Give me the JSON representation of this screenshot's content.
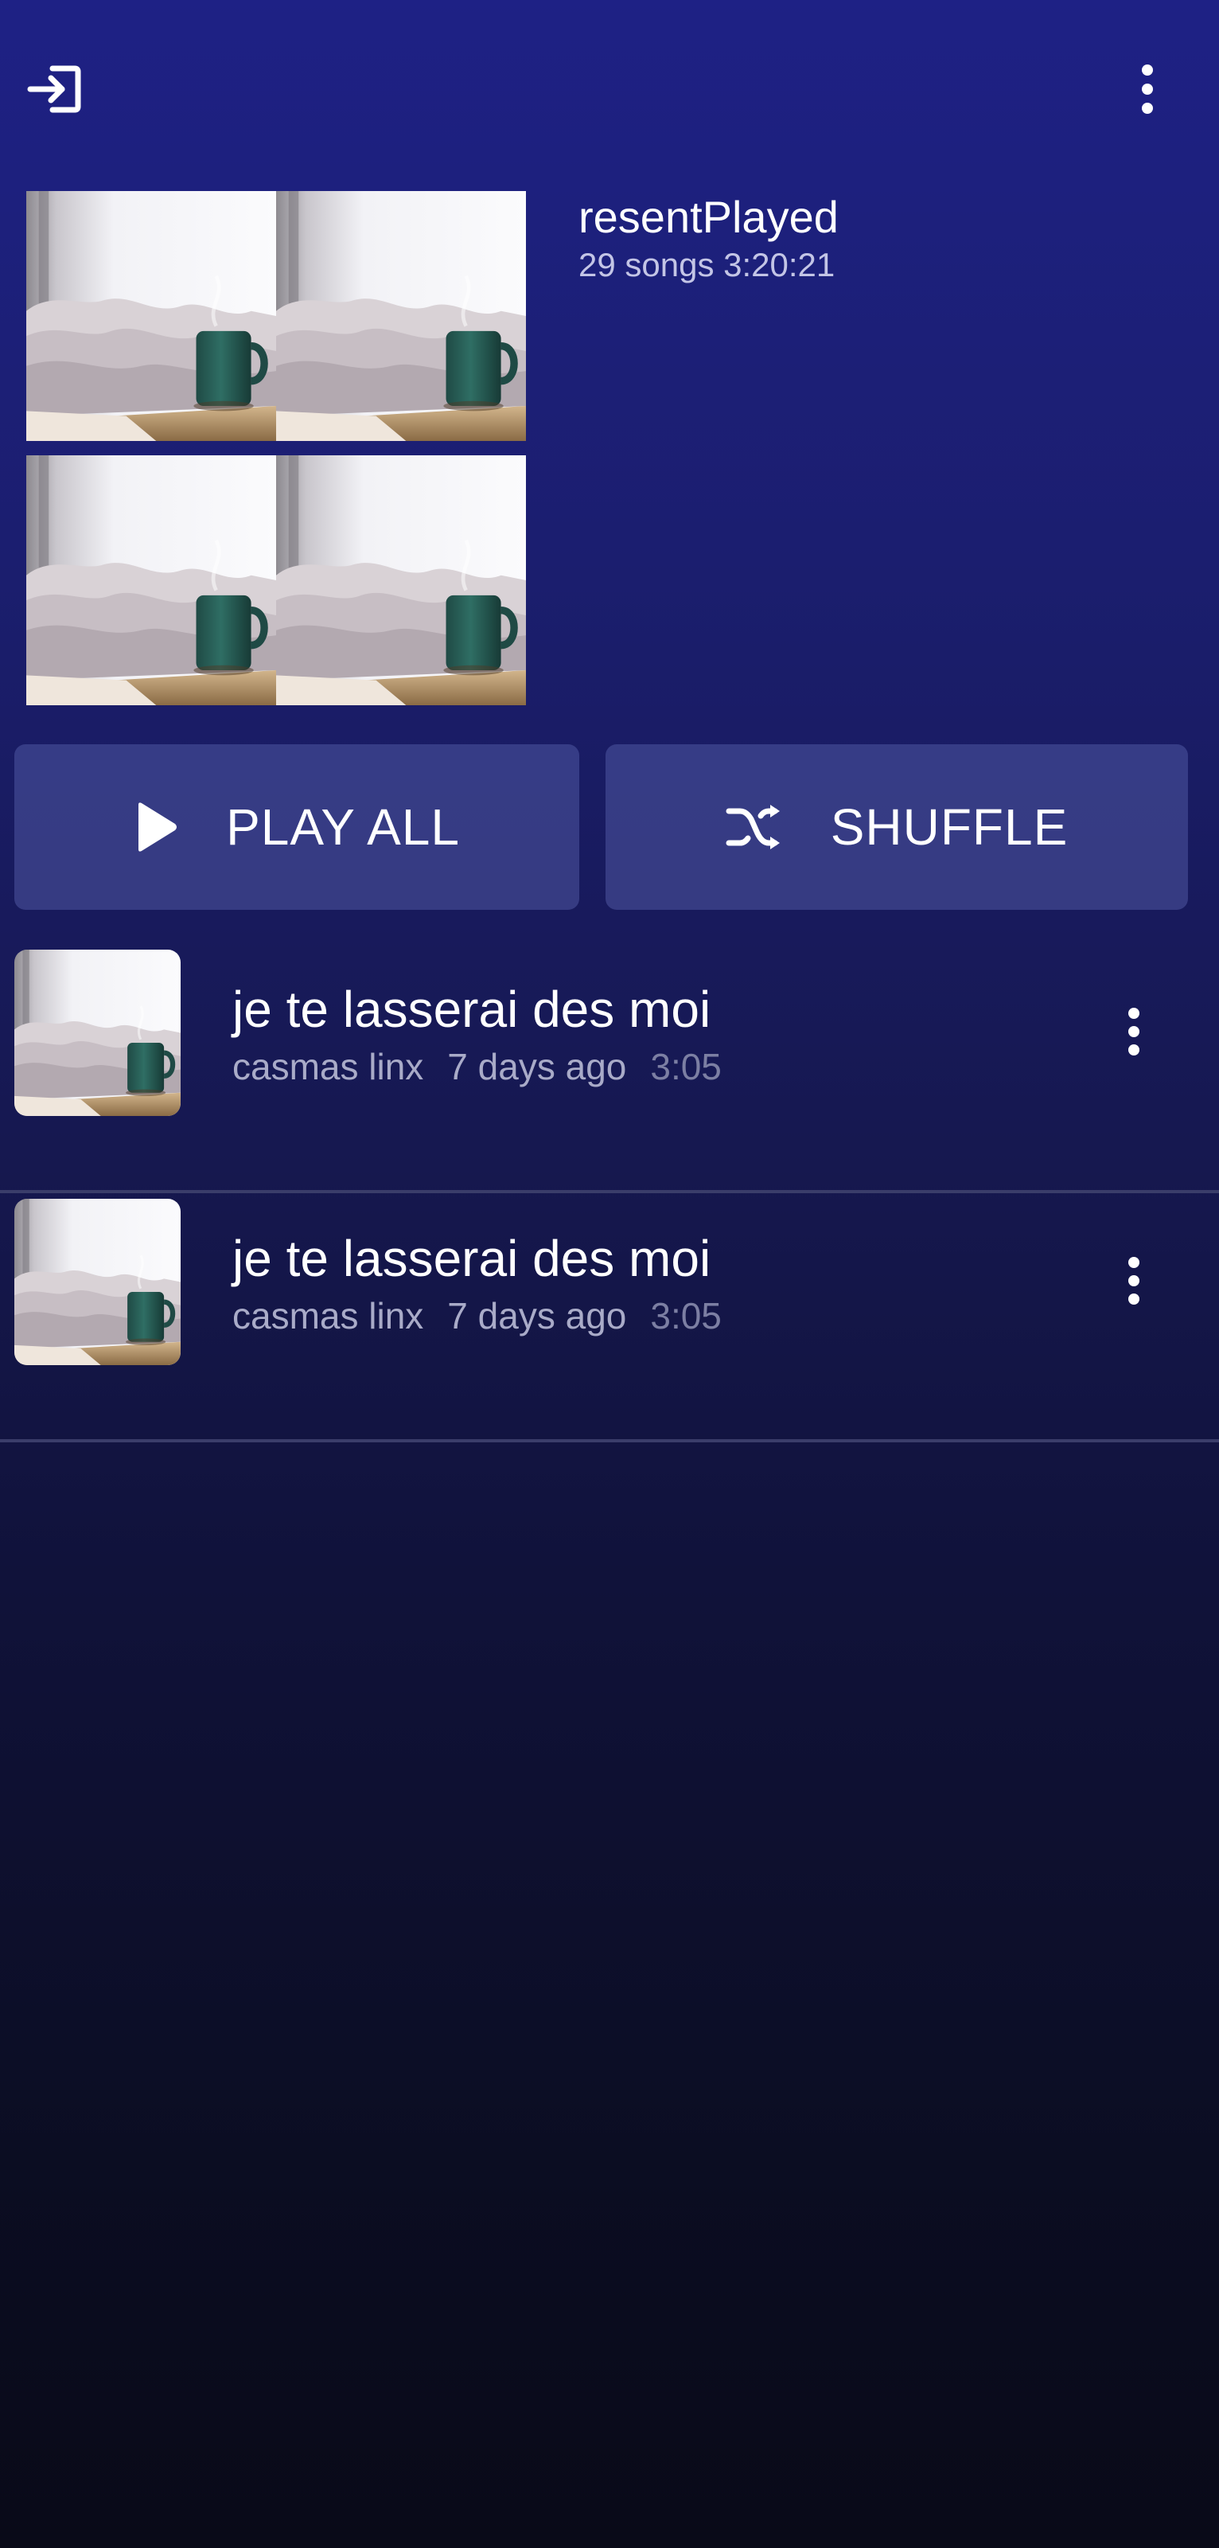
{
  "header": {
    "login_icon": "login-icon",
    "menu_icon": "more-vert-icon"
  },
  "playlist": {
    "title": "resentPlayed",
    "meta": "29 songs 3:20:21"
  },
  "actions": {
    "play_all_label": "PLAY ALL",
    "play_icon": "play-icon",
    "shuffle_label": "SHUFFLE",
    "shuffle_icon": "shuffle-icon"
  },
  "songs": [
    {
      "title": "je te lasserai des moi",
      "artist": "casmas linx",
      "added": "7 days ago",
      "duration": "3:05"
    },
    {
      "title": "je te lasserai des moi",
      "artist": "casmas linx",
      "added": "7 days ago",
      "duration": "3:05"
    }
  ],
  "colors": {
    "background_top": "#1e2185",
    "background_bottom": "#090a18",
    "button_bg": "#3e4590",
    "divider": "#3a3d6a"
  }
}
